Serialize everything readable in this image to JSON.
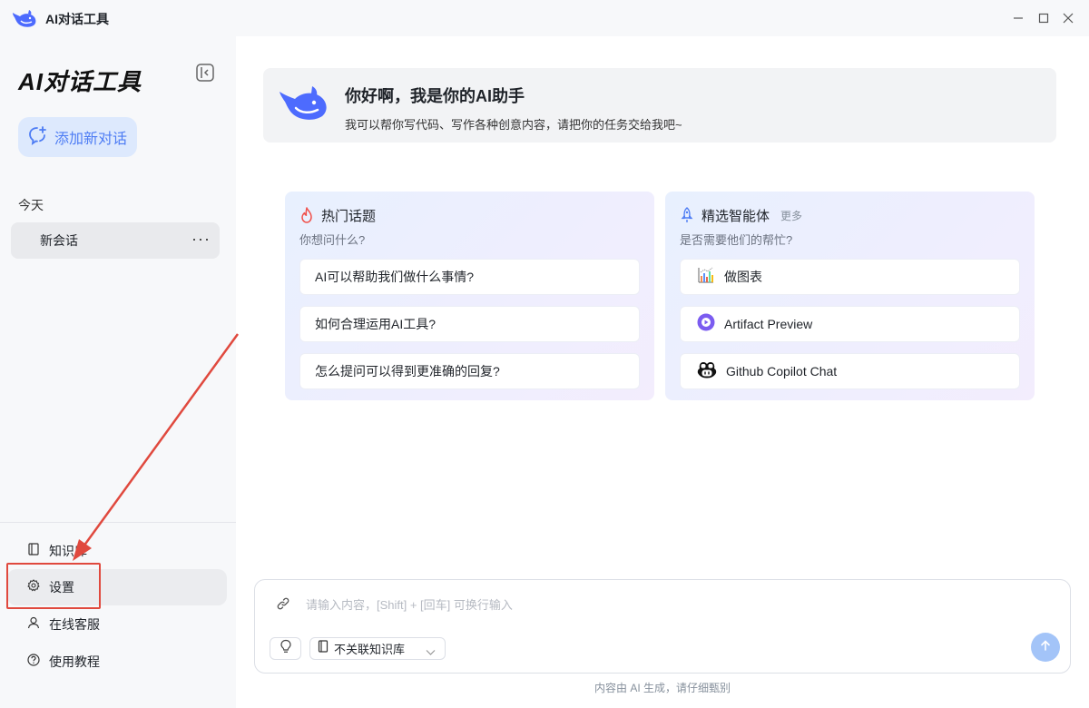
{
  "window": {
    "title": "AI对话工具"
  },
  "sidebar": {
    "brand": "AI对话工具",
    "new_chat_label": "添加新对话",
    "group_title": "今天",
    "conversations": [
      {
        "title": "新会话",
        "more": "···"
      }
    ],
    "menu": [
      {
        "label": "知识库",
        "icon": "book-icon"
      },
      {
        "label": "设置",
        "icon": "gear-icon"
      },
      {
        "label": "在线客服",
        "icon": "person-icon"
      },
      {
        "label": "使用教程",
        "icon": "help-icon"
      }
    ]
  },
  "greeting": {
    "title": "你好啊，我是你的AI助手",
    "subtitle": "我可以帮你写代码、写作各种创意内容，请把你的任务交给我吧~"
  },
  "hot_topics": {
    "title": "热门话题",
    "subtitle": "你想问什么?",
    "items": [
      "AI可以帮助我们做什么事情?",
      "如何合理运用AI工具?",
      "怎么提问可以得到更准确的回复?"
    ]
  },
  "agents": {
    "title": "精选智能体",
    "more_label": "更多",
    "subtitle": "是否需要他们的帮忙?",
    "items": [
      {
        "label": "做图表",
        "icon": "chart-icon"
      },
      {
        "label": "Artifact Preview",
        "icon": "artifact-icon"
      },
      {
        "label": "Github Copilot Chat",
        "icon": "copilot-icon"
      }
    ]
  },
  "composer": {
    "placeholder": "请输入内容，[Shift] + [回车] 可换行输入",
    "value": "",
    "kb_select": "不关联知识库"
  },
  "footer_note": "内容由 AI 生成，请仔细甄别",
  "colors": {
    "accent": "#4d7cf4",
    "annotation": "#e0493e",
    "send_disabled": "#a3c4f8"
  }
}
